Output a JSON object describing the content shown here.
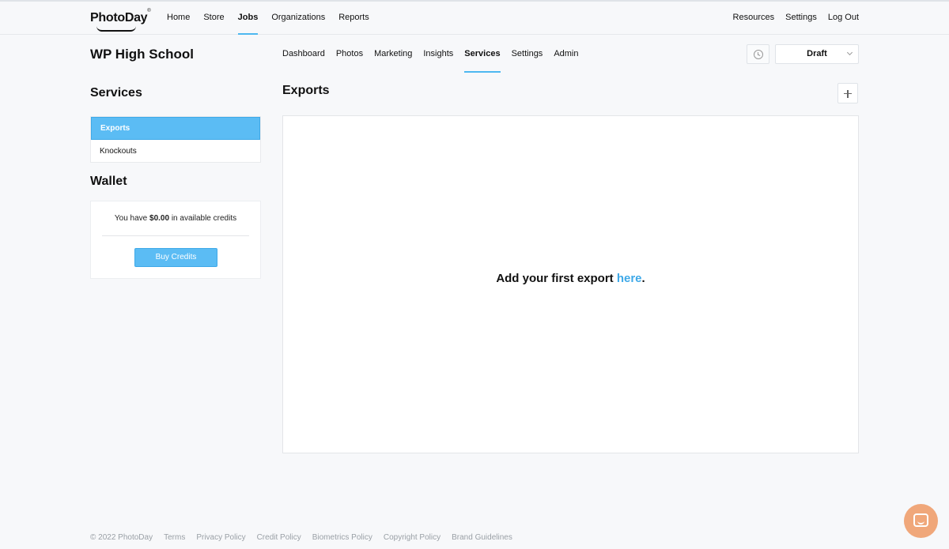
{
  "app": {
    "logo_text": "PhotoDay",
    "logo_mark": "®"
  },
  "topnav": {
    "items": [
      {
        "label": "Home"
      },
      {
        "label": "Store"
      },
      {
        "label": "Jobs",
        "active": true
      },
      {
        "label": "Organizations"
      },
      {
        "label": "Reports"
      }
    ],
    "right_items": [
      {
        "label": "Resources"
      },
      {
        "label": "Settings"
      },
      {
        "label": "Log Out"
      }
    ]
  },
  "job": {
    "title": "WP High School",
    "tabs": [
      {
        "label": "Dashboard"
      },
      {
        "label": "Photos"
      },
      {
        "label": "Marketing"
      },
      {
        "label": "Insights"
      },
      {
        "label": "Services",
        "active": true
      },
      {
        "label": "Settings"
      },
      {
        "label": "Admin"
      }
    ],
    "status": "Draft"
  },
  "sidebar": {
    "services_title": "Services",
    "services": [
      {
        "label": "Exports",
        "active": true
      },
      {
        "label": "Knockouts"
      }
    ],
    "wallet_title": "Wallet",
    "wallet": {
      "text_before": "You have ",
      "amount": "$0.00",
      "text_after": " in available credits",
      "buy_label": "Buy Credits"
    }
  },
  "main": {
    "title": "Exports",
    "empty_before": "Add your first export ",
    "empty_link": "here",
    "empty_after": "."
  },
  "footer": {
    "items": [
      "© 2022 PhotoDay",
      "Terms",
      "Privacy Policy",
      "Credit Policy",
      "Biometrics Policy",
      "Copyright Policy",
      "Brand Guidelines"
    ]
  },
  "colors": {
    "accent": "#5bbcf4",
    "link": "#3fa9e8",
    "chat_bubble": "#f0a77a"
  }
}
